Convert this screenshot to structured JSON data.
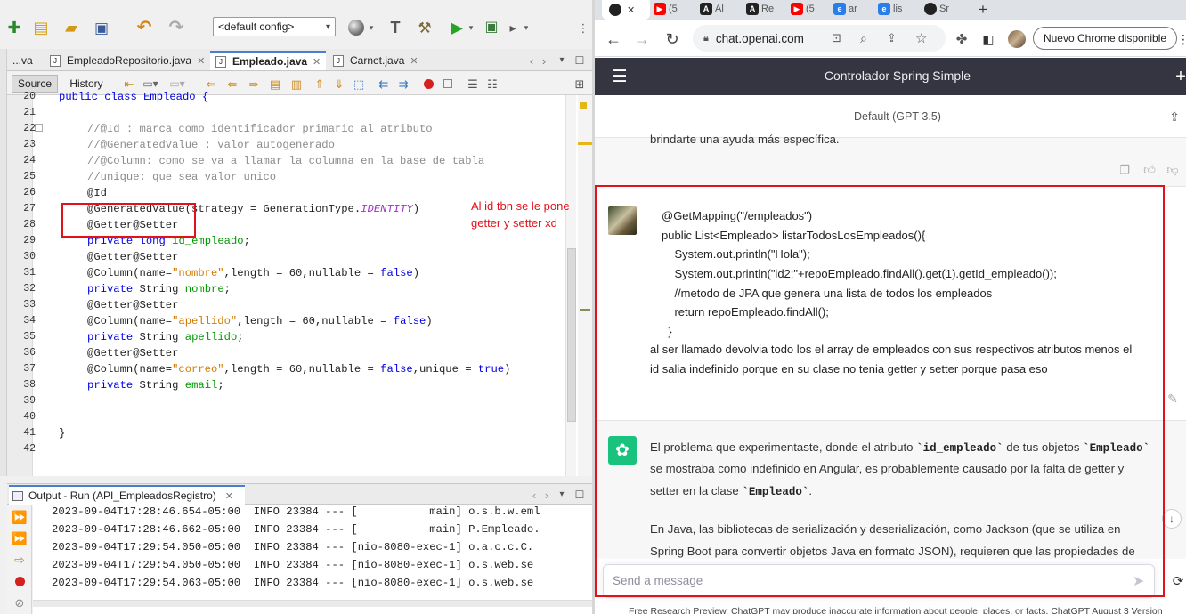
{
  "ide": {
    "toolbar": {
      "config_value": "<default config>"
    },
    "editor_tabs": [
      {
        "label": "...va",
        "closable": false
      },
      {
        "label": "EmpleadoRepositorio.java",
        "closable": true
      },
      {
        "label": "Empleado.java",
        "closable": true,
        "active": true
      },
      {
        "label": "Carnet.java",
        "closable": true
      }
    ],
    "source_tab": "Source",
    "history_tab": "History",
    "line_numbers": [
      "20",
      "21",
      "22",
      "23",
      "24",
      "25",
      "26",
      "27",
      "28",
      "29",
      "30",
      "31",
      "32",
      "33",
      "34",
      "35",
      "36",
      "37",
      "38",
      "39",
      "40",
      "41",
      "42"
    ],
    "code": {
      "l20": "public class Empleado {",
      "l22": "//@Id : marca como identificador primario al atributo",
      "l23": "//@GeneratedValue : valor autogenerado",
      "l24": "//@Column: como se va a llamar la columna en la base de tabla",
      "l25": "//unique: que sea valor unico",
      "l26": "@Id",
      "l27a": "@GeneratedValue(strategy = GenerationType.",
      "l27b": "IDENTITY",
      "l27c": ")",
      "getter_setter": "@Getter@Setter",
      "kw_private": "private",
      "kw_long": "long",
      "f_id": "id_empleado",
      "semi": ";",
      "col_open": "@Column(name=",
      "s_nombre": "\"nombre\"",
      "s_apellido": "\"apellido\"",
      "s_correo": "\"correo\"",
      "len_nullable": ",length = 60,nullable = ",
      "kw_false": "false",
      "unique_part": ",unique = ",
      "kw_true": "true",
      "close_paren": ")",
      "t_string": "String",
      "f_nombre": "nombre",
      "f_apellido": "apellido",
      "f_email": "email",
      "l41": "}"
    },
    "annotation": {
      "line1": "Al id tbn se le pone",
      "line2": "getter y setter xd"
    },
    "output": {
      "title": "Output - Run (API_EmpleadosRegistro)",
      "lines": [
        "2023-09-04T17:28:46.654-05:00  INFO 23384 --- [           main] o.s.b.w.eml",
        "2023-09-04T17:28:46.662-05:00  INFO 23384 --- [           main] P.Empleado.",
        "2023-09-04T17:29:54.050-05:00  INFO 23384 --- [nio-8080-exec-1] o.a.c.c.C.",
        "2023-09-04T17:29:54.050-05:00  INFO 23384 --- [nio-8080-exec-1] o.s.web.se",
        "2023-09-04T17:29:54.063-05:00  INFO 23384 --- [nio-8080-exec-1] o.s.web.se"
      ]
    }
  },
  "browser": {
    "tabs": [
      {
        "label": "(5",
        "icon": "youtube-icon",
        "color": "#ff0000"
      },
      {
        "label": "Al",
        "icon": "angular-icon",
        "color": "#222222"
      },
      {
        "label": "Re",
        "icon": "angular-icon",
        "color": "#222222"
      },
      {
        "label": "(5",
        "icon": "youtube-icon",
        "color": "#ff0000"
      },
      {
        "label": "ar",
        "icon": "edge-icon",
        "color": "#2b7de9"
      },
      {
        "label": "lis",
        "icon": "edge-icon",
        "color": "#2b7de9"
      },
      {
        "label": "Sr",
        "icon": "github-icon",
        "color": "#222222"
      }
    ],
    "url": "chat.openai.com",
    "update_button": "Nuevo Chrome disponible"
  },
  "chatgpt": {
    "title": "Controlador Spring Simple",
    "model": "Default (GPT-3.5)",
    "prev_text": "brindarte una ayuda más específica.",
    "user_code": [
      "@GetMapping(\"/empleados\")",
      "public List<Empleado> listarTodosLosEmpleados(){",
      "    System.out.println(\"Hola\");",
      "    System.out.println(\"id2:\"+repoEmpleado.findAll().get(1).getId_empleado());",
      "    //metodo de JPA que genera una lista de todos los empleados",
      "    return repoEmpleado.findAll();",
      "  }"
    ],
    "user_text1": "al ser llamado devolvia todo los el array de empleados con sus respectivos atributos menos el",
    "user_text2": "id salia indefinido porque en su clase no tenia getter y setter porque pasa eso",
    "ai": {
      "p1a": "El problema que experimentaste, donde el atributo ",
      "c_id": "`id_empleado`",
      "p1b": " de tus objetos ",
      "c_emp": "`Empleado`",
      "p2": "se mostraba como indefinido en Angular, es probablemente causado por la falta de getter y",
      "p3a": "setter en la clase ",
      "c_emp2": "`Empleado`",
      "p3b": ".",
      "p4": "En Java, las bibliotecas de serialización y deserialización, como Jackson (que se utiliza en",
      "p5": "Spring Boot para convertir objetos Java en formato JSON), requieren que las propiedades de"
    },
    "input_placeholder": "Send a message",
    "footer": "Free Research Preview. ChatGPT may produce inaccurate information about people, places, or facts. ChatGPT August 3 Version"
  },
  "colors": {
    "highlight_red": "#e0131b",
    "annotation_red": "#e0131b",
    "chatgpt_green": "#19c37d",
    "navbar_dark": "#343541"
  }
}
